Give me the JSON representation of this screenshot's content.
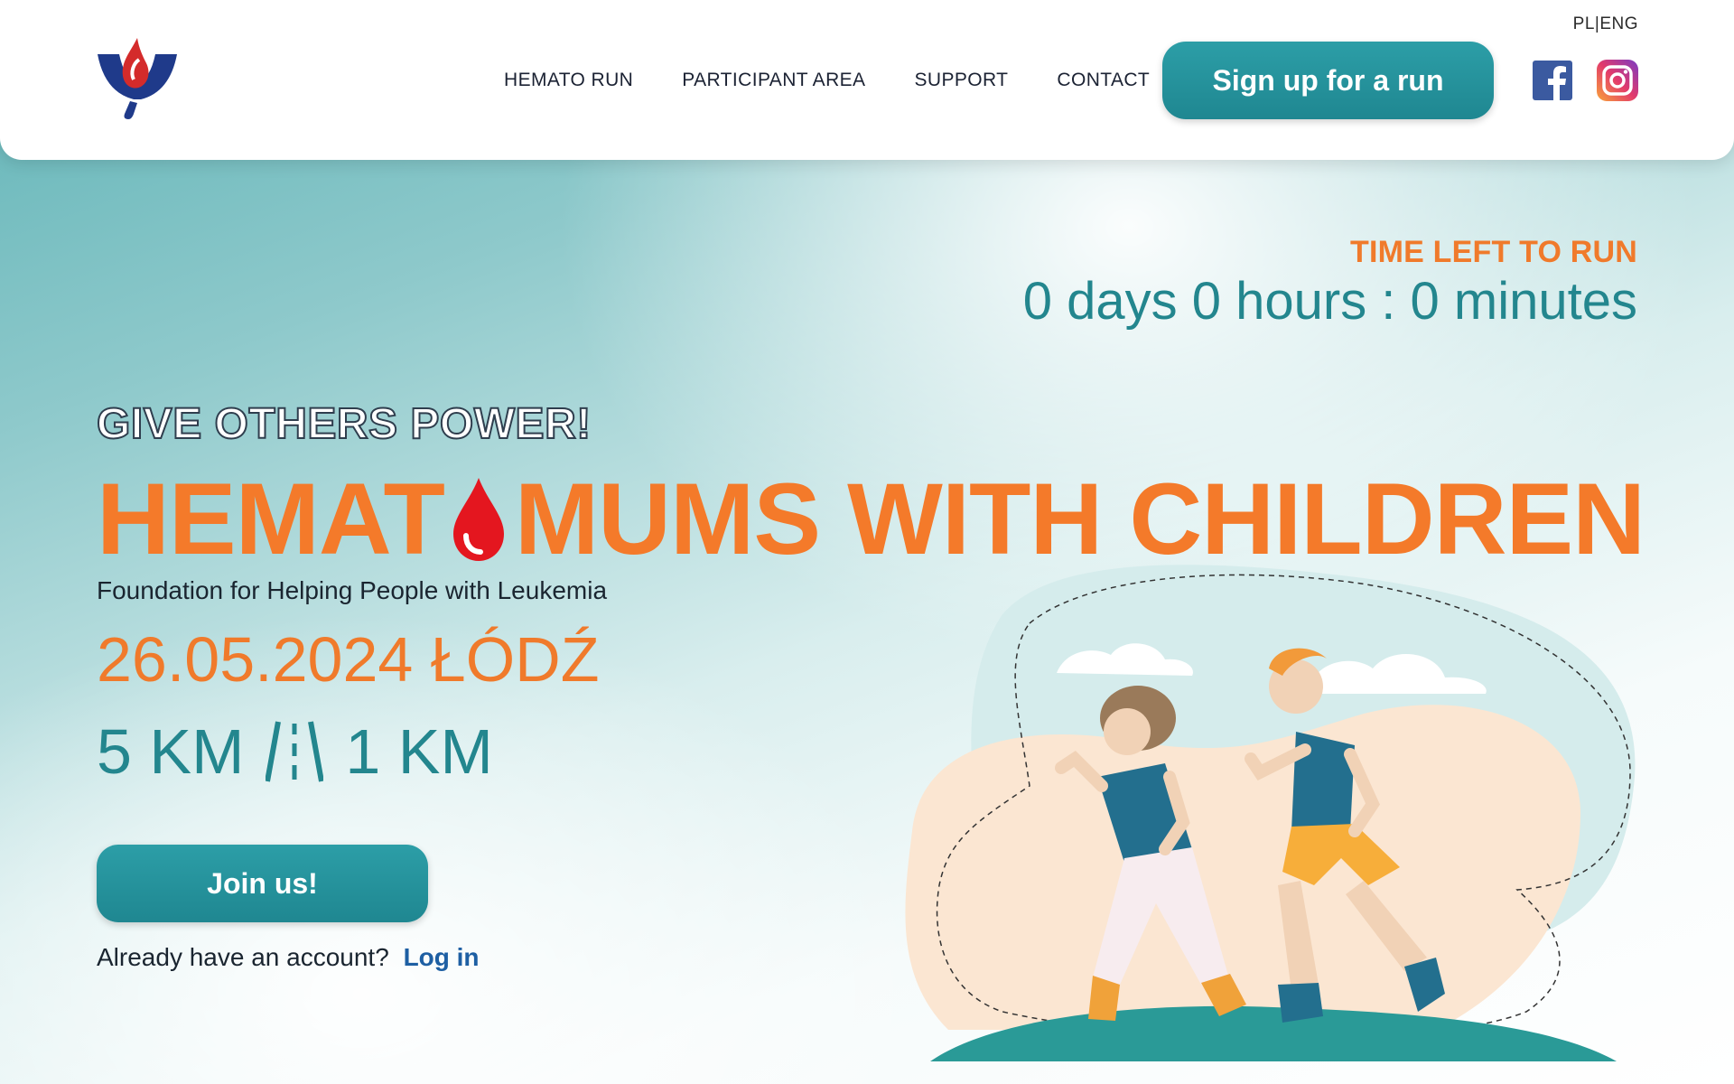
{
  "header": {
    "lang_switch": "PL|ENG",
    "nav": [
      "HEMATO RUN",
      "PARTICIPANT AREA",
      "SUPPORT",
      "CONTACT"
    ],
    "signup_label": "Sign up for a run",
    "social": [
      "facebook-icon",
      "instagram-icon"
    ]
  },
  "countdown": {
    "label": "TIME LEFT TO RUN",
    "value": "0 days 0 hours : 0 minutes"
  },
  "hero": {
    "tagline": "GIVE OTHERS POWER!",
    "title_part1": "HEMAT",
    "title_part2": "MUMS WITH CHILDREN",
    "subtitle": "Foundation for Helping People with Leukemia",
    "date": "26.05.2024 ŁÓDŹ",
    "distance_1": "5 KM",
    "distance_2": "1 KM",
    "join_label": "Join us!",
    "account_prompt": "Already have an account?",
    "login_label": "Log in"
  },
  "colors": {
    "accent_orange": "#f47a2a",
    "accent_teal": "#23868e",
    "button_teal": "#2c9ea7",
    "link_blue": "#1e5fa3"
  }
}
